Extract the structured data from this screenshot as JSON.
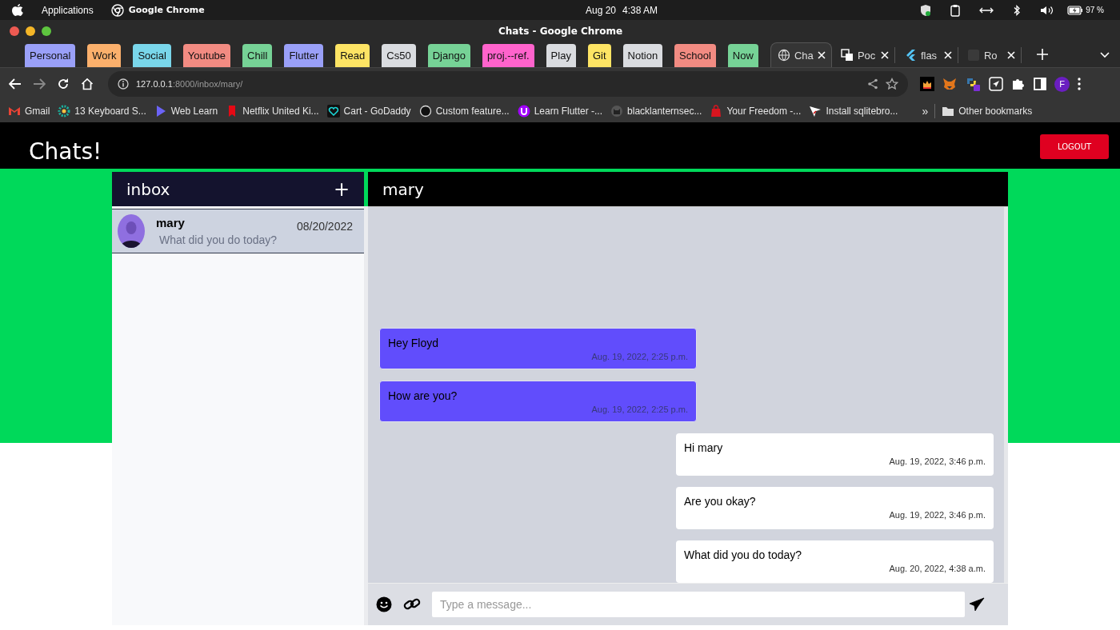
{
  "menu_bar": {
    "app_menu": "Applications",
    "active_app": "Google Chrome",
    "date": "Aug 20",
    "time": "4:38 AM",
    "battery": "97 %"
  },
  "window": {
    "title": "Chats - Google Chrome"
  },
  "tab_groups": [
    {
      "label": "Personal",
      "color": "#9aa0f8"
    },
    {
      "label": "Work",
      "color": "#fbb06c"
    },
    {
      "label": "Social",
      "color": "#79d6ea"
    },
    {
      "label": "Youtube",
      "color": "#f28b82"
    },
    {
      "label": "Chill",
      "color": "#76d296"
    },
    {
      "label": "Flutter",
      "color": "#9aa0f8"
    },
    {
      "label": "Read",
      "color": "#fde464"
    },
    {
      "label": "Cs50",
      "color": "#dadce0"
    },
    {
      "label": "Django",
      "color": "#76d296"
    },
    {
      "label": "proj.--ref.",
      "color": "#ff63cc"
    },
    {
      "label": "Play",
      "color": "#dadce0"
    },
    {
      "label": "Git",
      "color": "#fde464"
    },
    {
      "label": "Notion",
      "color": "#dadce0"
    },
    {
      "label": "School",
      "color": "#f28b82"
    },
    {
      "label": "Now",
      "color": "#76d296"
    }
  ],
  "tabs": [
    {
      "label": "Cha",
      "selected": true
    },
    {
      "label": "Poc",
      "selected": false
    },
    {
      "label": "flas",
      "selected": false
    },
    {
      "label": "Ro",
      "selected": false
    }
  ],
  "address_bar": {
    "host": "127.0.0.1",
    "path": ":8000/inbox/mary/"
  },
  "profile": {
    "initial": "F"
  },
  "bookmarks": [
    "Gmail",
    "13 Keyboard S...",
    "Web Learn",
    "Netflix United Ki...",
    "Cart - GoDaddy",
    "Custom feature...",
    "Learn Flutter -...",
    "blacklanternsec...",
    "Your Freedom -...",
    "Install sqlitebro..."
  ],
  "more_bookmarks": "»",
  "other_bookmarks": "Other bookmarks",
  "app": {
    "brand": "Chats!",
    "logout": "LOGOUT",
    "inbox": {
      "title": "inbox",
      "add": "+",
      "conversations": [
        {
          "name": "mary",
          "preview": "What did you do today?",
          "date": "08/20/2022",
          "selected": true
        }
      ]
    },
    "chat": {
      "title": "mary",
      "messages": [
        {
          "text": "Hey Floyd",
          "time": "Aug. 19, 2022, 2:25 p.m.",
          "kind": "received"
        },
        {
          "text": "How are you?",
          "time": "Aug. 19, 2022, 2:25 p.m.",
          "kind": "received"
        },
        {
          "text": "Hi mary",
          "time": "Aug. 19, 2022, 3:46 p.m.",
          "kind": "sent"
        },
        {
          "text": "Are you okay?",
          "time": "Aug. 19, 2022, 3:46 p.m.",
          "kind": "sent"
        },
        {
          "text": "What did you do today?",
          "time": "Aug. 20, 2022, 4:38 a.m.",
          "kind": "sent"
        }
      ],
      "composer": {
        "placeholder": "Type a message..."
      }
    }
  }
}
